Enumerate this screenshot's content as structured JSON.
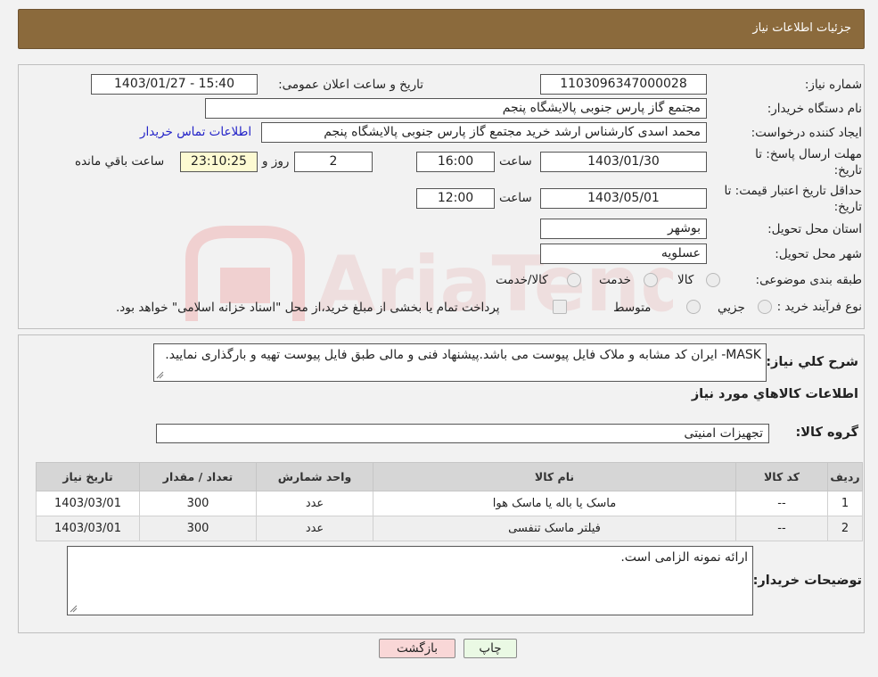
{
  "header": {
    "title": "جزئیات اطلاعات نیاز"
  },
  "form": {
    "need_number_label": "شماره نیاز:",
    "need_number": "1103096347000028",
    "announce_label": "تاریخ و ساعت اعلان عمومی:",
    "announce_value": "1403/01/27 - 15:40",
    "buyer_org_label": "نام دستگاه خریدار:",
    "buyer_org": "مجتمع گاز پارس جنوبی  پالایشگاه پنجم",
    "creator_label": "ایجاد کننده درخواست:",
    "creator": "محمد اسدی کارشناس ارشد خرید مجتمع گاز پارس جنوبی  پالایشگاه پنجم",
    "contact_link": "اطلاعات تماس خریدار",
    "deadline_label_1": "مهلت ارسال پاسخ: تا",
    "deadline_label_2": "تاریخ:",
    "deadline_date": "1403/01/30",
    "time_label": "ساعت",
    "deadline_time": "16:00",
    "days_value": "2",
    "days_label": "روز و",
    "remaining_time": "23:10:25",
    "remaining_label": "ساعت باقي مانده",
    "validity_label_1": "حداقل تاریخ اعتبار قیمت: تا",
    "validity_label_2": "تاریخ:",
    "validity_date": "1403/05/01",
    "validity_time_label": "ساعت",
    "validity_time": "12:00",
    "province_label": "استان محل تحویل:",
    "province": "بوشهر",
    "city_label": "شهر محل تحویل:",
    "city": "عسلویه",
    "category_label": "طبقه بندی موضوعی:",
    "category_options": [
      "کالا",
      "خدمت",
      "کالا/خدمت"
    ],
    "process_label": "نوع فرآیند خرید :",
    "process_options": [
      "جزيي",
      "متوسط"
    ],
    "payment_note": "پرداخت تمام یا بخشی از مبلغ خرید،از محل \"اسناد خزانه اسلامی\" خواهد بود."
  },
  "description": {
    "label": "شرح كلي نياز:",
    "text": "MASK- ایران کد مشابه و ملاک فایل پیوست می باشد.پیشنهاد فنی و مالی طبق فایل پیوست تهیه و بارگذاری نمایید."
  },
  "goods": {
    "section_title": "اطلاعات کالاهاي مورد نياز",
    "group_label": "گروه کالا:",
    "group_value": "تجهیزات امنیتی",
    "columns": [
      "ردیف",
      "کد کالا",
      "نام کالا",
      "واحد شمارش",
      "تعداد / مقدار",
      "تاریخ نیاز"
    ],
    "rows": [
      {
        "row": "1",
        "code": "--",
        "name": "ماسک یا باله یا ماسک هوا",
        "unit": "عدد",
        "qty": "300",
        "date": "1403/03/01"
      },
      {
        "row": "2",
        "code": "--",
        "name": "فیلتر ماسک تنفسی",
        "unit": "عدد",
        "qty": "300",
        "date": "1403/03/01"
      }
    ]
  },
  "buyer_notes": {
    "label": "توضیحات خریدار:",
    "text": "ارائه نمونه الزامی است."
  },
  "buttons": {
    "print": "چاپ",
    "back": "بازگشت"
  },
  "watermark": {
    "text": "AriaTender.neT"
  },
  "colors": {
    "header": "#8b6a3c",
    "link": "#2323c8",
    "highlight": "#fdfad2",
    "back_button": "#f9d7d7",
    "print_button": "#eaf9e4"
  }
}
